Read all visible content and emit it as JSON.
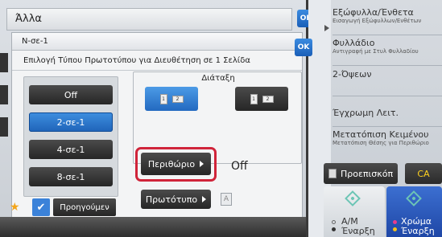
{
  "colors": {
    "accent": "#1f63b8",
    "highlight": "#d0243a",
    "ca": "#ffd21f",
    "start_teal": "#6cc5b5"
  },
  "background": {
    "title": "Άλλα",
    "ok": "OK"
  },
  "dialog": {
    "title": "Ν-σε-1",
    "ok": "OK",
    "subtitle": "Επιλογή Τύπου Πρωτοτύπου για Διευθέτηση σε 1 Σελίδα",
    "nup_options": [
      {
        "label": "Off",
        "selected": false
      },
      {
        "label": "2-σε-1",
        "selected": true
      },
      {
        "label": "4-σε-1",
        "selected": false
      },
      {
        "label": "8-σε-1",
        "selected": false
      }
    ],
    "layout_label": "Διάταξη",
    "layout_icons": {
      "a1": "1",
      "a2": "2",
      "b1": "1",
      "b2": "2"
    },
    "border_button": "Περιθώριο",
    "border_value": "Off",
    "original_button": "Πρωτότυπο",
    "original_icon": "A"
  },
  "sidebar": {
    "items": [
      {
        "title": "Εξώφυλλα/Ένθετα",
        "sub": "Εισαγωγή Εξώφυλλων/Ενθέτων"
      },
      {
        "title": "Φυλλάδιο",
        "sub": "Αντιγραφή με Στυλ Φυλλαδίου"
      },
      {
        "title": "2-Όψεων",
        "sub": ""
      },
      {
        "title": "Έγχρωμη Λειτ.",
        "sub": ""
      },
      {
        "title": "Μετατόπιση Κειμένου",
        "sub": "Μετατόπιση Θέσης για Περιθώριο"
      }
    ],
    "preview": "Προεπισκόπ",
    "ca": "CA",
    "bw_start": "Α/Μ\nΈναρξη",
    "color_start": "Χρώμα\nΈναρξη"
  },
  "bottom": {
    "prev": "Προηγούμεν"
  }
}
